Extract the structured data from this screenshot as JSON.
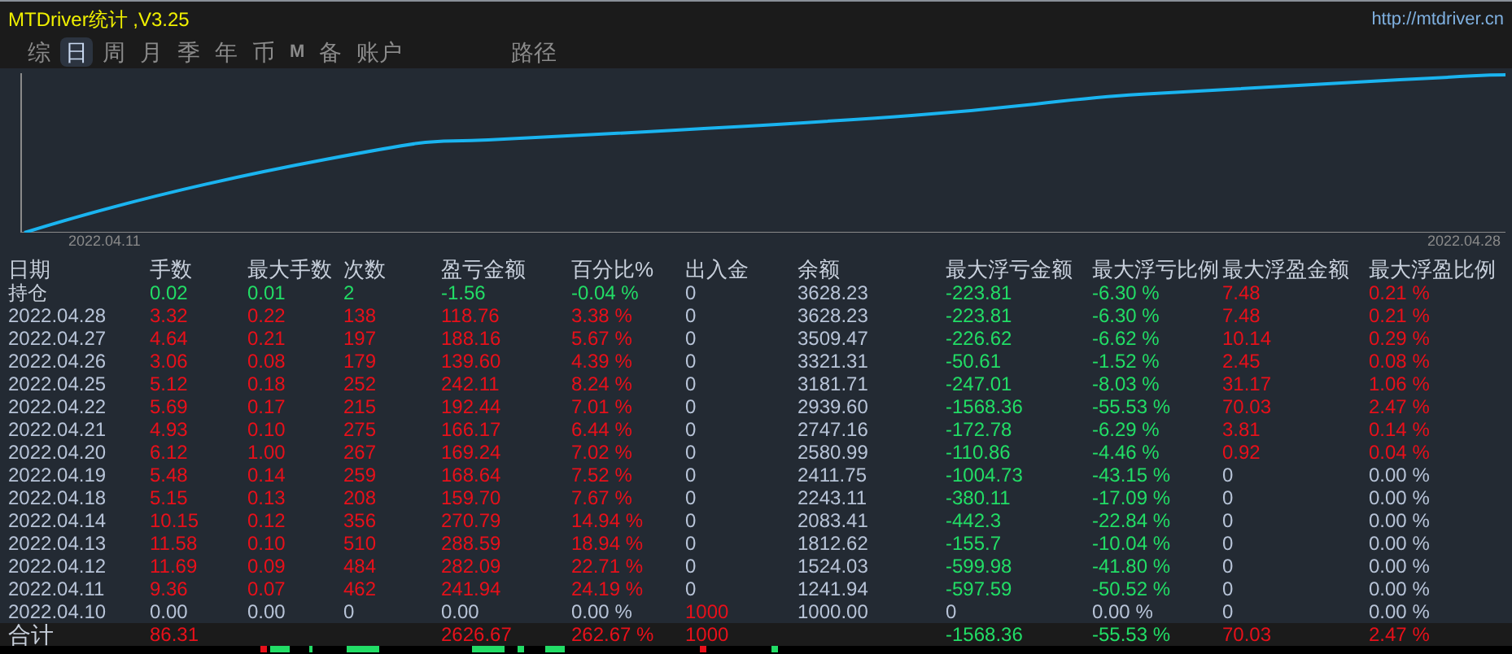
{
  "window": {
    "title": "MTDriver统计 ,V3.25",
    "url": "http://mtdriver.cn"
  },
  "tabs": [
    {
      "label": "综",
      "selected": false,
      "kind": "text"
    },
    {
      "label": "日",
      "selected": true,
      "kind": "text"
    },
    {
      "label": "周",
      "selected": false,
      "kind": "text"
    },
    {
      "label": "月",
      "selected": false,
      "kind": "text"
    },
    {
      "label": "季",
      "selected": false,
      "kind": "text"
    },
    {
      "label": "年",
      "selected": false,
      "kind": "text"
    },
    {
      "label": "币",
      "selected": false,
      "kind": "text"
    },
    {
      "label": "M",
      "selected": false,
      "kind": "letter"
    },
    {
      "label": "备",
      "selected": false,
      "kind": "text"
    },
    {
      "label": "账户",
      "selected": false,
      "kind": "text"
    }
  ],
  "path_tab": {
    "label": "路径",
    "selected": false
  },
  "chart": {
    "start_label": "2022.04.11",
    "end_label": "2022.04.28"
  },
  "table": {
    "columns": [
      "日期",
      "手数",
      "最大手数",
      "次数",
      "盈亏金额",
      "百分比%",
      "出入金",
      "余额",
      "最大浮亏金额",
      "最大浮亏比例",
      "最大浮盈金额",
      "最大浮盈比例"
    ],
    "rows": [
      {
        "cells": [
          {
            "text": "持仓",
            "color": "#c8d0dc"
          },
          {
            "text": "0.02",
            "color": "#22dd66"
          },
          {
            "text": "0.01",
            "color": "#22dd66"
          },
          {
            "text": "2",
            "color": "#22dd66"
          },
          {
            "text": "-1.56",
            "color": "#22dd66"
          },
          {
            "text": "-0.04 %",
            "color": "#22dd66"
          },
          {
            "text": "0",
            "color": "#b8c4d8"
          },
          {
            "text": "3628.23",
            "color": "#b8c4d8"
          },
          {
            "text": "-223.81",
            "color": "#22dd66"
          },
          {
            "text": "-6.30 %",
            "color": "#22dd66"
          },
          {
            "text": "7.48",
            "color": "#e8101a"
          },
          {
            "text": "0.21 %",
            "color": "#e8101a"
          }
        ]
      },
      {
        "cells": [
          {
            "text": "2022.04.28",
            "color": "#b8c4d8"
          },
          {
            "text": "3.32",
            "color": "#e8101a"
          },
          {
            "text": "0.22",
            "color": "#e8101a"
          },
          {
            "text": "138",
            "color": "#e8101a"
          },
          {
            "text": "118.76",
            "color": "#e8101a"
          },
          {
            "text": "3.38 %",
            "color": "#e8101a"
          },
          {
            "text": "0",
            "color": "#b8c4d8"
          },
          {
            "text": "3628.23",
            "color": "#b8c4d8"
          },
          {
            "text": "-223.81",
            "color": "#22dd66"
          },
          {
            "text": "-6.30 %",
            "color": "#22dd66"
          },
          {
            "text": "7.48",
            "color": "#e8101a"
          },
          {
            "text": "0.21 %",
            "color": "#e8101a"
          }
        ]
      },
      {
        "cells": [
          {
            "text": "2022.04.27",
            "color": "#b8c4d8"
          },
          {
            "text": "4.64",
            "color": "#e8101a"
          },
          {
            "text": "0.21",
            "color": "#e8101a"
          },
          {
            "text": "197",
            "color": "#e8101a"
          },
          {
            "text": "188.16",
            "color": "#e8101a"
          },
          {
            "text": "5.67 %",
            "color": "#e8101a"
          },
          {
            "text": "0",
            "color": "#b8c4d8"
          },
          {
            "text": "3509.47",
            "color": "#b8c4d8"
          },
          {
            "text": "-226.62",
            "color": "#22dd66"
          },
          {
            "text": "-6.62 %",
            "color": "#22dd66"
          },
          {
            "text": "10.14",
            "color": "#e8101a"
          },
          {
            "text": "0.29 %",
            "color": "#e8101a"
          }
        ]
      },
      {
        "cells": [
          {
            "text": "2022.04.26",
            "color": "#b8c4d8"
          },
          {
            "text": "3.06",
            "color": "#e8101a"
          },
          {
            "text": "0.08",
            "color": "#e8101a"
          },
          {
            "text": "179",
            "color": "#e8101a"
          },
          {
            "text": "139.60",
            "color": "#e8101a"
          },
          {
            "text": "4.39 %",
            "color": "#e8101a"
          },
          {
            "text": "0",
            "color": "#b8c4d8"
          },
          {
            "text": "3321.31",
            "color": "#b8c4d8"
          },
          {
            "text": "-50.61",
            "color": "#22dd66"
          },
          {
            "text": "-1.52 %",
            "color": "#22dd66"
          },
          {
            "text": "2.45",
            "color": "#e8101a"
          },
          {
            "text": "0.08 %",
            "color": "#e8101a"
          }
        ]
      },
      {
        "cells": [
          {
            "text": "2022.04.25",
            "color": "#b8c4d8"
          },
          {
            "text": "5.12",
            "color": "#e8101a"
          },
          {
            "text": "0.18",
            "color": "#e8101a"
          },
          {
            "text": "252",
            "color": "#e8101a"
          },
          {
            "text": "242.11",
            "color": "#e8101a"
          },
          {
            "text": "8.24 %",
            "color": "#e8101a"
          },
          {
            "text": "0",
            "color": "#b8c4d8"
          },
          {
            "text": "3181.71",
            "color": "#b8c4d8"
          },
          {
            "text": "-247.01",
            "color": "#22dd66"
          },
          {
            "text": "-8.03 %",
            "color": "#22dd66"
          },
          {
            "text": "31.17",
            "color": "#e8101a"
          },
          {
            "text": "1.06 %",
            "color": "#e8101a"
          }
        ]
      },
      {
        "cells": [
          {
            "text": "2022.04.22",
            "color": "#b8c4d8"
          },
          {
            "text": "5.69",
            "color": "#e8101a"
          },
          {
            "text": "0.17",
            "color": "#e8101a"
          },
          {
            "text": "215",
            "color": "#e8101a"
          },
          {
            "text": "192.44",
            "color": "#e8101a"
          },
          {
            "text": "7.01 %",
            "color": "#e8101a"
          },
          {
            "text": "0",
            "color": "#b8c4d8"
          },
          {
            "text": "2939.60",
            "color": "#b8c4d8"
          },
          {
            "text": "-1568.36",
            "color": "#22dd66"
          },
          {
            "text": "-55.53 %",
            "color": "#22dd66"
          },
          {
            "text": "70.03",
            "color": "#e8101a"
          },
          {
            "text": "2.47 %",
            "color": "#e8101a"
          }
        ]
      },
      {
        "cells": [
          {
            "text": "2022.04.21",
            "color": "#b8c4d8"
          },
          {
            "text": "4.93",
            "color": "#e8101a"
          },
          {
            "text": "0.10",
            "color": "#e8101a"
          },
          {
            "text": "275",
            "color": "#e8101a"
          },
          {
            "text": "166.17",
            "color": "#e8101a"
          },
          {
            "text": "6.44 %",
            "color": "#e8101a"
          },
          {
            "text": "0",
            "color": "#b8c4d8"
          },
          {
            "text": "2747.16",
            "color": "#b8c4d8"
          },
          {
            "text": "-172.78",
            "color": "#22dd66"
          },
          {
            "text": "-6.29 %",
            "color": "#22dd66"
          },
          {
            "text": "3.81",
            "color": "#e8101a"
          },
          {
            "text": "0.14 %",
            "color": "#e8101a"
          }
        ]
      },
      {
        "cells": [
          {
            "text": "2022.04.20",
            "color": "#b8c4d8"
          },
          {
            "text": "6.12",
            "color": "#e8101a"
          },
          {
            "text": "1.00",
            "color": "#e8101a"
          },
          {
            "text": "267",
            "color": "#e8101a"
          },
          {
            "text": "169.24",
            "color": "#e8101a"
          },
          {
            "text": "7.02 %",
            "color": "#e8101a"
          },
          {
            "text": "0",
            "color": "#b8c4d8"
          },
          {
            "text": "2580.99",
            "color": "#b8c4d8"
          },
          {
            "text": "-110.86",
            "color": "#22dd66"
          },
          {
            "text": "-4.46 %",
            "color": "#22dd66"
          },
          {
            "text": "0.92",
            "color": "#e8101a"
          },
          {
            "text": "0.04 %",
            "color": "#e8101a"
          }
        ]
      },
      {
        "cells": [
          {
            "text": "2022.04.19",
            "color": "#b8c4d8"
          },
          {
            "text": "5.48",
            "color": "#e8101a"
          },
          {
            "text": "0.14",
            "color": "#e8101a"
          },
          {
            "text": "259",
            "color": "#e8101a"
          },
          {
            "text": "168.64",
            "color": "#e8101a"
          },
          {
            "text": "7.52 %",
            "color": "#e8101a"
          },
          {
            "text": "0",
            "color": "#b8c4d8"
          },
          {
            "text": "2411.75",
            "color": "#b8c4d8"
          },
          {
            "text": "-1004.73",
            "color": "#22dd66"
          },
          {
            "text": "-43.15 %",
            "color": "#22dd66"
          },
          {
            "text": "0",
            "color": "#b8c4d8"
          },
          {
            "text": "0.00 %",
            "color": "#b8c4d8"
          }
        ]
      },
      {
        "cells": [
          {
            "text": "2022.04.18",
            "color": "#b8c4d8"
          },
          {
            "text": "5.15",
            "color": "#e8101a"
          },
          {
            "text": "0.13",
            "color": "#e8101a"
          },
          {
            "text": "208",
            "color": "#e8101a"
          },
          {
            "text": "159.70",
            "color": "#e8101a"
          },
          {
            "text": "7.67 %",
            "color": "#e8101a"
          },
          {
            "text": "0",
            "color": "#b8c4d8"
          },
          {
            "text": "2243.11",
            "color": "#b8c4d8"
          },
          {
            "text": "-380.11",
            "color": "#22dd66"
          },
          {
            "text": "-17.09 %",
            "color": "#22dd66"
          },
          {
            "text": "0",
            "color": "#b8c4d8"
          },
          {
            "text": "0.00 %",
            "color": "#b8c4d8"
          }
        ]
      },
      {
        "cells": [
          {
            "text": "2022.04.14",
            "color": "#b8c4d8"
          },
          {
            "text": "10.15",
            "color": "#e8101a"
          },
          {
            "text": "0.12",
            "color": "#e8101a"
          },
          {
            "text": "356",
            "color": "#e8101a"
          },
          {
            "text": "270.79",
            "color": "#e8101a"
          },
          {
            "text": "14.94 %",
            "color": "#e8101a"
          },
          {
            "text": "0",
            "color": "#b8c4d8"
          },
          {
            "text": "2083.41",
            "color": "#b8c4d8"
          },
          {
            "text": "-442.3",
            "color": "#22dd66"
          },
          {
            "text": "-22.84 %",
            "color": "#22dd66"
          },
          {
            "text": "0",
            "color": "#b8c4d8"
          },
          {
            "text": "0.00 %",
            "color": "#b8c4d8"
          }
        ]
      },
      {
        "cells": [
          {
            "text": "2022.04.13",
            "color": "#b8c4d8"
          },
          {
            "text": "11.58",
            "color": "#e8101a"
          },
          {
            "text": "0.10",
            "color": "#e8101a"
          },
          {
            "text": "510",
            "color": "#e8101a"
          },
          {
            "text": "288.59",
            "color": "#e8101a"
          },
          {
            "text": "18.94 %",
            "color": "#e8101a"
          },
          {
            "text": "0",
            "color": "#b8c4d8"
          },
          {
            "text": "1812.62",
            "color": "#b8c4d8"
          },
          {
            "text": "-155.7",
            "color": "#22dd66"
          },
          {
            "text": "-10.04 %",
            "color": "#22dd66"
          },
          {
            "text": "0",
            "color": "#b8c4d8"
          },
          {
            "text": "0.00 %",
            "color": "#b8c4d8"
          }
        ]
      },
      {
        "cells": [
          {
            "text": "2022.04.12",
            "color": "#b8c4d8"
          },
          {
            "text": "11.69",
            "color": "#e8101a"
          },
          {
            "text": "0.09",
            "color": "#e8101a"
          },
          {
            "text": "484",
            "color": "#e8101a"
          },
          {
            "text": "282.09",
            "color": "#e8101a"
          },
          {
            "text": "22.71 %",
            "color": "#e8101a"
          },
          {
            "text": "0",
            "color": "#b8c4d8"
          },
          {
            "text": "1524.03",
            "color": "#b8c4d8"
          },
          {
            "text": "-599.98",
            "color": "#22dd66"
          },
          {
            "text": "-41.80 %",
            "color": "#22dd66"
          },
          {
            "text": "0",
            "color": "#b8c4d8"
          },
          {
            "text": "0.00 %",
            "color": "#b8c4d8"
          }
        ]
      },
      {
        "cells": [
          {
            "text": "2022.04.11",
            "color": "#b8c4d8"
          },
          {
            "text": "9.36",
            "color": "#e8101a"
          },
          {
            "text": "0.07",
            "color": "#e8101a"
          },
          {
            "text": "462",
            "color": "#e8101a"
          },
          {
            "text": "241.94",
            "color": "#e8101a"
          },
          {
            "text": "24.19 %",
            "color": "#e8101a"
          },
          {
            "text": "0",
            "color": "#b8c4d8"
          },
          {
            "text": "1241.94",
            "color": "#b8c4d8"
          },
          {
            "text": "-597.59",
            "color": "#22dd66"
          },
          {
            "text": "-50.52 %",
            "color": "#22dd66"
          },
          {
            "text": "0",
            "color": "#b8c4d8"
          },
          {
            "text": "0.00 %",
            "color": "#b8c4d8"
          }
        ]
      },
      {
        "cells": [
          {
            "text": "2022.04.10",
            "color": "#b8c4d8"
          },
          {
            "text": "0.00",
            "color": "#b8c4d8"
          },
          {
            "text": "0.00",
            "color": "#b8c4d8"
          },
          {
            "text": "0",
            "color": "#b8c4d8"
          },
          {
            "text": "0.00",
            "color": "#b8c4d8"
          },
          {
            "text": "0.00 %",
            "color": "#b8c4d8"
          },
          {
            "text": "1000",
            "color": "#e8101a"
          },
          {
            "text": "1000.00",
            "color": "#b8c4d8"
          },
          {
            "text": "0",
            "color": "#b8c4d8"
          },
          {
            "text": "0.00 %",
            "color": "#b8c4d8"
          },
          {
            "text": "0",
            "color": "#b8c4d8"
          },
          {
            "text": "0.00 %",
            "color": "#b8c4d8"
          }
        ]
      }
    ],
    "total": {
      "cells": [
        {
          "text": "合计",
          "color": "#c8d0dc"
        },
        {
          "text": "86.31",
          "color": "#e8101a"
        },
        null,
        null,
        {
          "text": "2626.67",
          "color": "#e8101a"
        },
        {
          "text": "262.67 %",
          "color": "#e8101a"
        },
        {
          "text": "1000",
          "color": "#e8101a"
        },
        null,
        {
          "text": "-1568.36",
          "color": "#22dd66"
        },
        {
          "text": "-55.53 %",
          "color": "#22dd66"
        },
        {
          "text": "70.03",
          "color": "#e8101a"
        },
        {
          "text": "2.47 %",
          "color": "#e8101a"
        }
      ]
    }
  }
}
